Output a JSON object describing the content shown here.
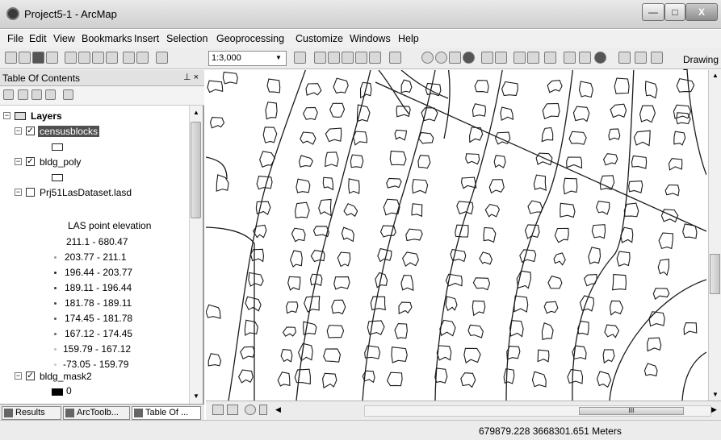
{
  "window": {
    "title": "Project5-1 - ArcMap",
    "min": "—",
    "max": "□",
    "close": "X"
  },
  "menu": [
    "File",
    "Edit",
    "View",
    "Bookmarks",
    "Insert",
    "Selection",
    "Geoprocessing",
    "Customize",
    "Windows",
    "Help"
  ],
  "toolbar": {
    "scale": "1:3,000",
    "drawing_label": "Drawing ▾"
  },
  "toc": {
    "title": "Table Of Contents",
    "pin": "⊥ ×",
    "layers_label": "Layers",
    "layers": [
      {
        "name": "censusblocks",
        "checked": true
      },
      {
        "name": "bldg_poly",
        "checked": true
      },
      {
        "name": "Prj51LasDataset.lasd",
        "checked": false
      },
      {
        "name": "bldg_mask2",
        "checked": true
      }
    ],
    "las_heading": "LAS point elevation",
    "las_classes": [
      "211.1 - 680.47",
      "203.77 - 211.1",
      "196.44 - 203.77",
      "189.11 - 196.44",
      "181.78 - 189.11",
      "174.45 - 181.78",
      "167.12 - 174.45",
      "159.79 - 167.12",
      "-73.05 - 159.79"
    ],
    "las_colors": [
      "#ffffff",
      "#9a9a9a",
      "#222222",
      "#333333",
      "#444444",
      "#555555",
      "#666666",
      "#bbbbbb",
      "#cccccc"
    ],
    "mask_value": "0"
  },
  "tabs": [
    "Results",
    "ArcToolb...",
    "Table Of ..."
  ],
  "hscroll_thumb": "III",
  "status": {
    "coordinates": "679879.228  3668301.651 Meters"
  }
}
